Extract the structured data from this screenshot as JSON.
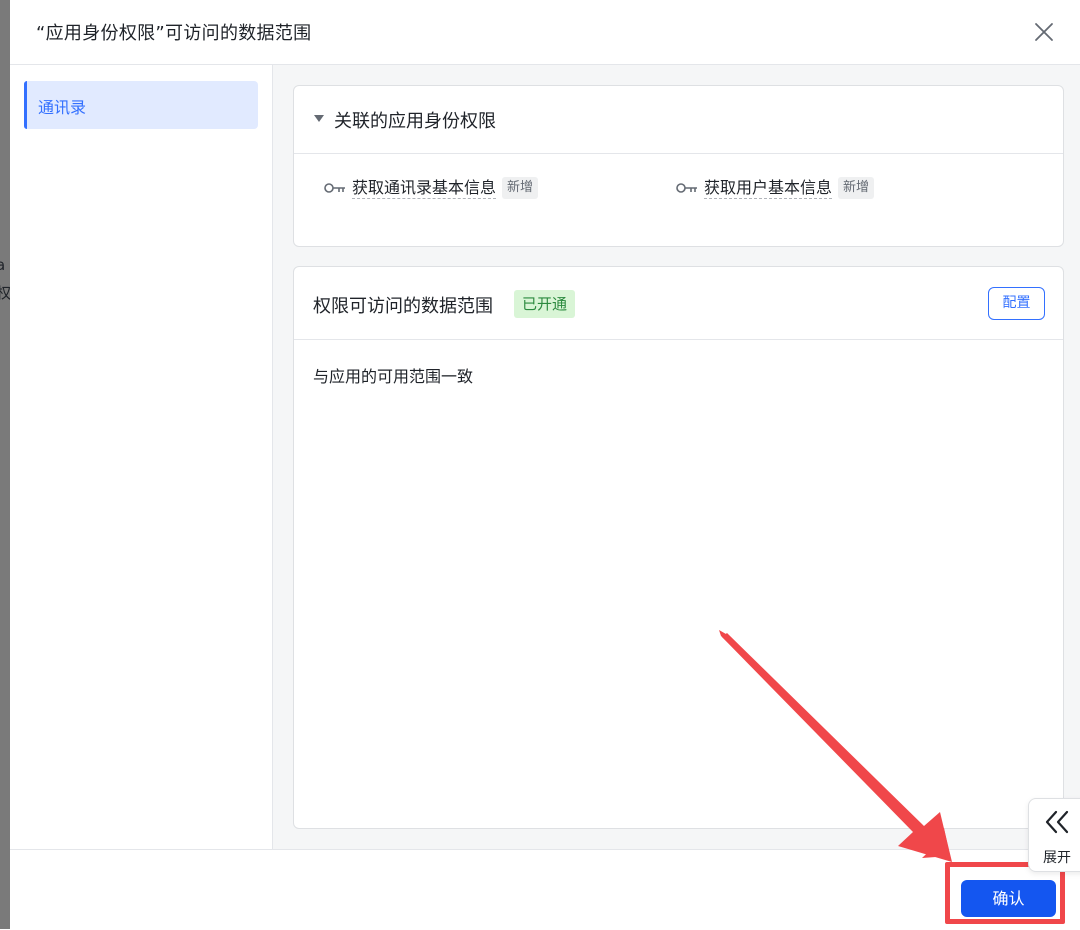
{
  "background": {
    "fragments": [
      "a",
      "权"
    ]
  },
  "dialog": {
    "title": "“应用身份权限”可访问的数据范围",
    "close_icon": "close-icon"
  },
  "sidebar": {
    "items": [
      {
        "label": "通讯录",
        "active": true
      }
    ]
  },
  "linked_permissions": {
    "title": "关联的应用身份权限",
    "items": [
      {
        "label": "获取通讯录基本信息",
        "tag": "新增",
        "icon": "key-icon"
      },
      {
        "label": "获取用户基本信息",
        "tag": "新增",
        "icon": "key-icon"
      }
    ]
  },
  "data_scope": {
    "title": "权限可访问的数据范围",
    "status_tag": "已开通",
    "config_label": "配置",
    "description": "与应用的可用范围一致"
  },
  "expand_tab": {
    "label": "展开",
    "icon": "double-chevron-left-icon"
  },
  "footer": {
    "confirm_label": "确认"
  },
  "colors": {
    "accent": "#3370ff",
    "primary_button": "#1456f0",
    "annotation": "#f0474a",
    "status_bg": "#d9f5d6",
    "status_text": "#2b8a3e"
  }
}
